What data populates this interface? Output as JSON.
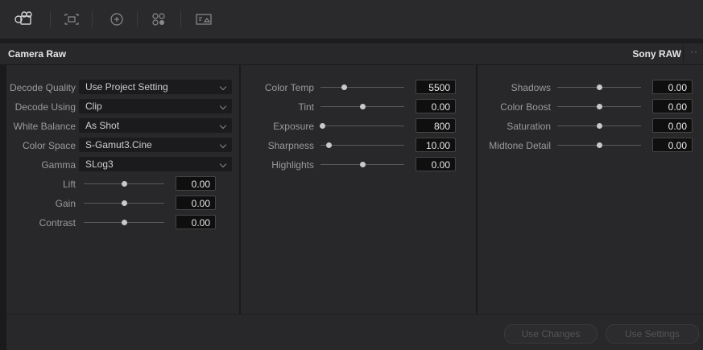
{
  "toolbar": {
    "icons": [
      "camera-icon",
      "match-frame-icon",
      "target-icon",
      "color-wheels-icon",
      "image-info-icon"
    ]
  },
  "header": {
    "title": "Camera Raw",
    "format": "Sony RAW",
    "more": "··"
  },
  "decode": {
    "quality": {
      "label": "Decode Quality",
      "value": "Use Project Setting"
    },
    "using": {
      "label": "Decode Using",
      "value": "Clip"
    },
    "white_balance": {
      "label": "White Balance",
      "value": "As Shot"
    },
    "color_space": {
      "label": "Color Space",
      "value": "S-Gamut3.Cine"
    },
    "gamma": {
      "label": "Gamma",
      "value": "SLog3"
    }
  },
  "sliders_left": [
    {
      "label": "Lift",
      "value": "0.00",
      "level": 0.5
    },
    {
      "label": "Gain",
      "value": "0.00",
      "level": 0.5
    },
    {
      "label": "Contrast",
      "value": "0.00",
      "level": 0.5
    }
  ],
  "sliders_mid": [
    {
      "label": "Color Temp",
      "value": "5500",
      "level": 0.28
    },
    {
      "label": "Tint",
      "value": "0.00",
      "level": 0.5
    },
    {
      "label": "Exposure",
      "value": "800",
      "level": 0.02
    },
    {
      "label": "Sharpness",
      "value": "10.00",
      "level": 0.1
    },
    {
      "label": "Highlights",
      "value": "0.00",
      "level": 0.5
    }
  ],
  "sliders_right": [
    {
      "label": "Shadows",
      "value": "0.00",
      "level": 0.5
    },
    {
      "label": "Color Boost",
      "value": "0.00",
      "level": 0.5
    },
    {
      "label": "Saturation",
      "value": "0.00",
      "level": 0.5
    },
    {
      "label": "Midtone Detail",
      "value": "0.00",
      "level": 0.5
    }
  ],
  "footer": {
    "use_changes": "Use Changes",
    "use_settings": "Use Settings"
  }
}
